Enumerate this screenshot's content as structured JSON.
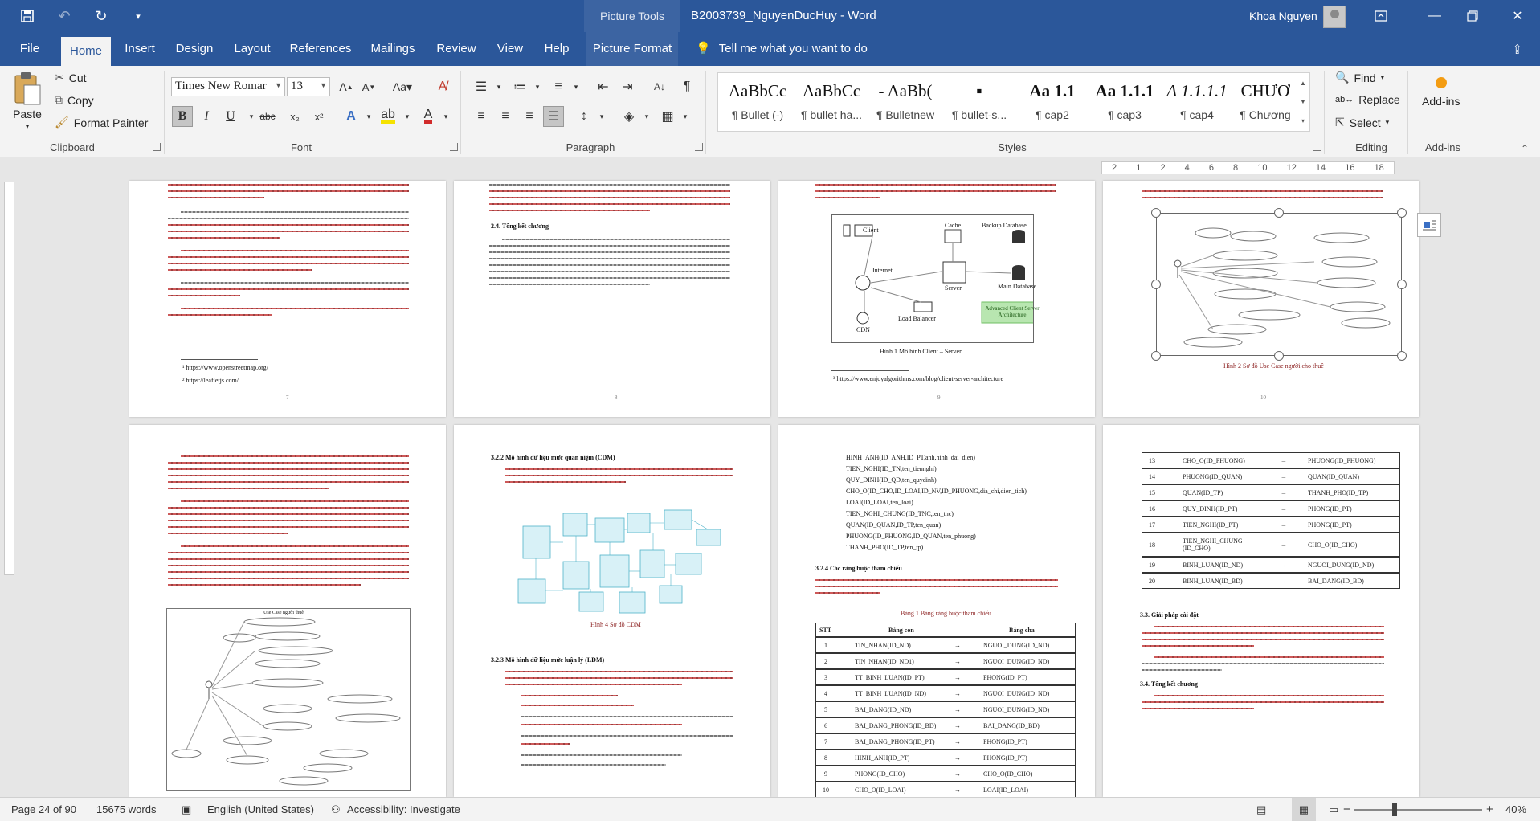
{
  "titlebar": {
    "context_tab": "Picture Tools",
    "document_title": "B2003739_NguyenDucHuy - Word",
    "user_name": "Khoa Nguyen"
  },
  "tabs": [
    "File",
    "Home",
    "Insert",
    "Design",
    "Layout",
    "References",
    "Mailings",
    "Review",
    "View",
    "Help",
    "Picture Format"
  ],
  "active_tab": "Home",
  "tell_me": "Tell me what you want to do",
  "clipboard": {
    "paste": "Paste",
    "cut": "Cut",
    "copy": "Copy",
    "format_painter": "Format Painter",
    "label": "Clipboard"
  },
  "font": {
    "name": "Times New Romar",
    "size": "13",
    "label": "Font"
  },
  "paragraph": {
    "label": "Paragraph"
  },
  "styles": {
    "label": "Styles",
    "items": [
      {
        "preview": "AaBbCc",
        "name": "¶ Bullet (-)"
      },
      {
        "preview": "AaBbCc",
        "name": "¶ bullet ha..."
      },
      {
        "preview": "- AaBb(",
        "name": "¶ Bulletnew"
      },
      {
        "preview": "▪",
        "name": "¶ bullet-s..."
      },
      {
        "preview": "Aa 1.1",
        "name": "¶ cap2"
      },
      {
        "preview": "Aa 1.1.1",
        "name": "¶ cap3"
      },
      {
        "preview": "A 1.1.1.1",
        "name": "¶ cap4"
      },
      {
        "preview": "CHƯƠ",
        "name": "¶ Chương"
      }
    ]
  },
  "editing": {
    "find": "Find",
    "replace": "Replace",
    "select": "Select",
    "label": "Editing"
  },
  "addins": {
    "button": "Add-ins",
    "label": "Add-ins"
  },
  "ruler": {
    "labels": [
      "2",
      "1",
      "2",
      "4",
      "6",
      "8",
      "10",
      "12",
      "14",
      "16",
      "18"
    ]
  },
  "pages": {
    "p7": {
      "footnote1": "¹ https://www.openstreetmap.org/",
      "footnote2": "² https://leafletjs.com/",
      "number": "7"
    },
    "p8": {
      "heading": "2.4.  Tổng kết chương",
      "number": "8"
    },
    "p9": {
      "diagram": {
        "client": "Client",
        "cache": "Cache",
        "backup_db": "Backup Database",
        "internet": "Internet",
        "server": "Server",
        "main_db": "Main Database",
        "cdn": "CDN",
        "load_balancer": "Load Balancer",
        "advanced": "Advanced Client Server Architecture"
      },
      "caption": "Hình 1 Mô hình Client – Server",
      "footnote": "³ https://www.enjoyalgorithms.com/blog/client-server-architecture",
      "number": "9"
    },
    "p10": {
      "caption": "Hình 2 Sơ đồ Use Case người cho thuê",
      "number": "10"
    },
    "p11": {
      "heading": "Use Case người thuê"
    },
    "p12": {
      "h1": "3.2.2  Mô hình dữ liệu mức quan niệm (CDM)",
      "caption": "Hình 4 Sơ đồ CDM",
      "h2": "3.2.3  Mô hình dữ liệu mức luận lý (LDM)"
    },
    "p13": {
      "lines": [
        "HINH_ANH(ID_ANH,ID_PT,anh,hinh_dai_dien)",
        "TIEN_NGHI(ID_TN,ten_tiennghi)",
        "QUY_DINH(ID_QD,ten_quydinh)",
        "CHO_O(ID_CHO,ID_LOAI,ID_NV,ID_PHUONG,dia_chi,dien_tich)",
        "LOAI(ID_LOAI,ten_loai)",
        "TIEN_NGHI_CHUNG(ID_TNC,ten_tnc)",
        "QUAN(ID_QUAN,ID_TP,ten_quan)",
        "PHUONG(ID_PHUONG,ID_QUAN,ten_phuong)",
        "THANH_PHO(ID_TP,ten_tp)"
      ],
      "h1": "3.2.4  Các ràng buộc tham chiếu",
      "table_caption": "Bảng 1 Bảng ràng buộc tham chiếu",
      "table_header": [
        "STT",
        "Bảng con",
        "",
        "Bảng cha"
      ],
      "rows": [
        [
          "1",
          "TIN_NHAN(ID_ND)",
          "→",
          "NGUOI_DUNG(ID_ND)"
        ],
        [
          "2",
          "TIN_NHAN(ID_ND1)",
          "→",
          "NGUOI_DUNG(ID_ND)"
        ],
        [
          "3",
          "TT_BINH_LUAN(ID_PT)",
          "→",
          "PHONG(ID_PT)"
        ],
        [
          "4",
          "TT_BINH_LUAN(ID_ND)",
          "→",
          "NGUOI_DUNG(ID_ND)"
        ],
        [
          "5",
          "BAI_DANG(ID_ND)",
          "→",
          "NGUOI_DUNG(ID_ND)"
        ],
        [
          "6",
          "BAI_DANG_PHONG(ID_BD)",
          "→",
          "BAI_DANG(ID_BD)"
        ],
        [
          "7",
          "BAI_DANG_PHONG(ID_PT)",
          "→",
          "PHONG(ID_PT)"
        ],
        [
          "8",
          "HINH_ANH(ID_PT)",
          "→",
          "PHONG(ID_PT)"
        ],
        [
          "9",
          "PHONG(ID_CHO)",
          "→",
          "CHO_O(ID_CHO)"
        ],
        [
          "10",
          "CHO_O(ID_LOAI)",
          "→",
          "LOAI(ID_LOAI)"
        ]
      ]
    },
    "p14": {
      "rows": [
        [
          "13",
          "CHO_O(ID_PHUONG)",
          "→",
          "PHUONG(ID_PHUONG)"
        ],
        [
          "14",
          "PHUONG(ID_QUAN)",
          "→",
          "QUAN(ID_QUAN)"
        ],
        [
          "15",
          "QUAN(ID_TP)",
          "→",
          "THANH_PHO(ID_TP)"
        ],
        [
          "16",
          "QUY_DINH(ID_PT)",
          "→",
          "PHONG(ID_PT)"
        ],
        [
          "17",
          "TIEN_NGHI(ID_PT)",
          "→",
          "PHONG(ID_PT)"
        ],
        [
          "18",
          "TIEN_NGHI_CHUNG (ID_CHO)",
          "→",
          "CHO_O(ID_CHO)"
        ],
        [
          "19",
          "BINH_LUAN(ID_ND)",
          "→",
          "NGUOI_DUNG(ID_ND)"
        ],
        [
          "20",
          "BINH_LUAN(ID_BD)",
          "→",
          "BAI_DANG(ID_BD)"
        ]
      ],
      "h1": "3.3.  Giải pháp cài đặt",
      "h2": "3.4.  Tổng kết chương"
    }
  },
  "status": {
    "page": "Page 24 of 90",
    "words": "15675 words",
    "language": "English (United States)",
    "accessibility": "Accessibility: Investigate",
    "zoom": "40%"
  }
}
